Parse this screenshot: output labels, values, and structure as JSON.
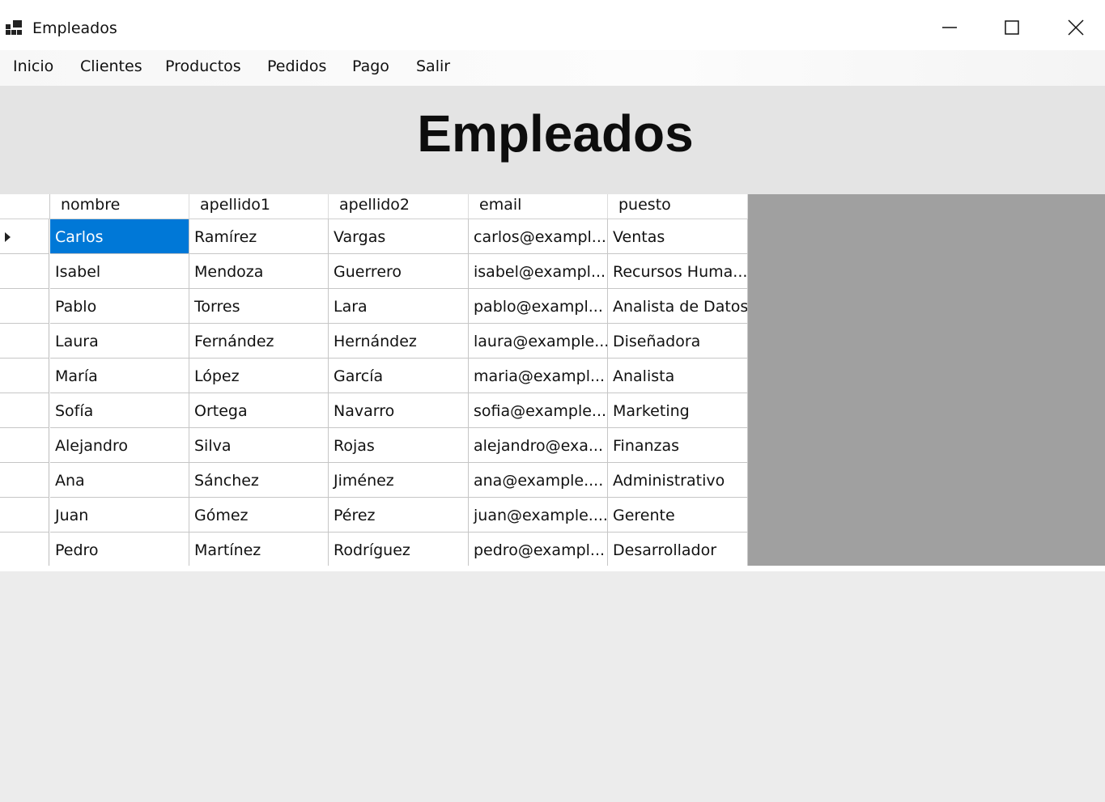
{
  "window": {
    "title": "Empleados",
    "icon": "app-window-icon",
    "controls": {
      "minimize_icon": "minimize-icon",
      "maximize_icon": "maximize-icon",
      "close_icon": "close-icon"
    }
  },
  "menu": {
    "items": [
      "Inicio",
      "Clientes",
      "Productos",
      "Pedidos",
      "Pago",
      "Salir"
    ]
  },
  "page": {
    "title": "Empleados"
  },
  "grid": {
    "columns": [
      "nombre",
      "apellido1",
      "apellido2",
      "email",
      "puesto"
    ],
    "rows": [
      [
        "Carlos",
        "Ramírez",
        "Vargas",
        "carlos@exampl...",
        "Ventas"
      ],
      [
        "Isabel",
        "Mendoza",
        "Guerrero",
        "isabel@exampl...",
        "Recursos Huma..."
      ],
      [
        "Pablo",
        "Torres",
        "Lara",
        "pablo@exampl...",
        "Analista de Datos"
      ],
      [
        "Laura",
        "Fernández",
        "Hernández",
        "laura@example...",
        "Diseñadora"
      ],
      [
        "María",
        "López",
        "García",
        "maria@exampl...",
        "Analista"
      ],
      [
        "Sofía",
        "Ortega",
        "Navarro",
        "sofia@example...",
        "Marketing"
      ],
      [
        "Alejandro",
        "Silva",
        "Rojas",
        "alejandro@exa...",
        "Finanzas"
      ],
      [
        "Ana",
        "Sánchez",
        "Jiménez",
        "ana@example....",
        "Administrativo"
      ],
      [
        "Juan",
        "Gómez",
        "Pérez",
        "juan@example....",
        "Gerente"
      ],
      [
        "Pedro",
        "Martínez",
        "Rodríguez",
        "pedro@exampl...",
        "Desarrollador"
      ]
    ],
    "current_row_icon": "row-pointer-icon"
  },
  "colors": {
    "selection": "#0078d7",
    "grid_background": "#a0a0a0",
    "header_panel": "#e4e4e4",
    "form_background": "#ececec"
  }
}
